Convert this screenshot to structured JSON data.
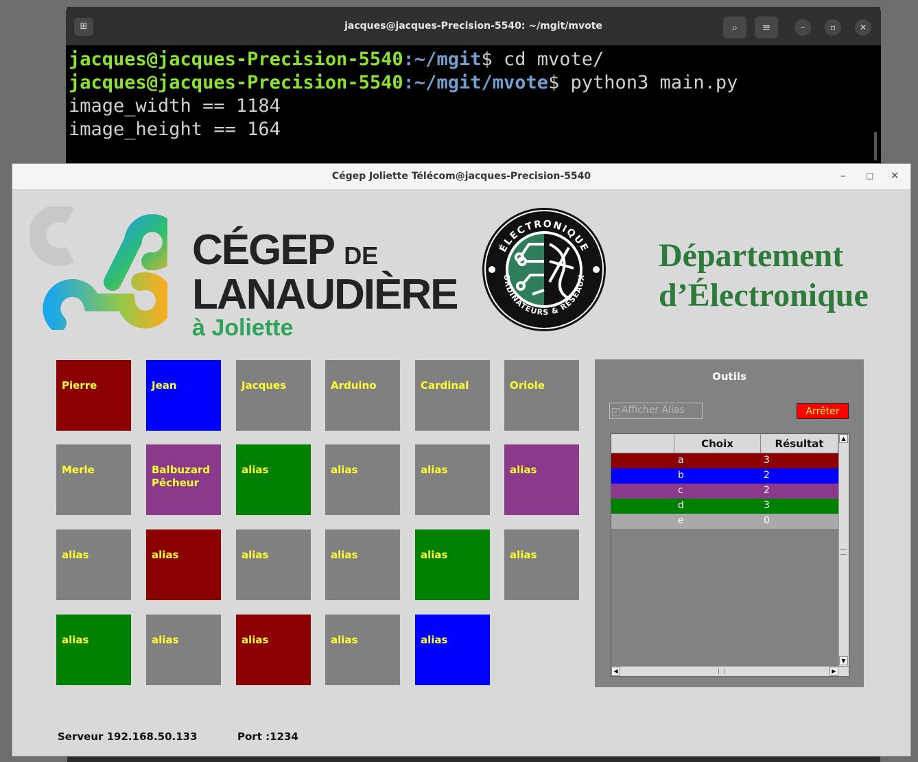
{
  "terminal": {
    "title": "jacques@jacques-Precision-5540: ~/mgit/mvote",
    "lines": [
      {
        "user": "jacques@jacques-Precision-5540",
        "path": ":~/mgit",
        "cmd": "$ cd mvote/"
      },
      {
        "user": "jacques@jacques-Precision-5540",
        "path": ":~/mgit/mvote",
        "cmd": "$ python3 main.py"
      }
    ],
    "output": [
      "image_width == 1184",
      "image_height == 164"
    ]
  },
  "app": {
    "title": "Cégep Joliette Télécom@jacques-Precision-5540",
    "header": {
      "cegep_line1": "CÉGEP",
      "cegep_de": "DE",
      "cegep_line2": "LANAUDIÈRE",
      "cegep_line3": "à Joliette",
      "badge_top": "ÉLECTRONIQUE",
      "badge_bottom": "ORDINATEURS & RÉSEAUX",
      "dept_line1": "Département",
      "dept_line2": "d’Électronique"
    },
    "tiles": [
      {
        "label": "Pierre",
        "color": "#8b0000"
      },
      {
        "label": "Jean",
        "color": "#0000ff"
      },
      {
        "label": "Jacques",
        "color": "#808080"
      },
      {
        "label": "Arduino",
        "color": "#808080"
      },
      {
        "label": "Cardinal",
        "color": "#808080"
      },
      {
        "label": "Oriole",
        "color": "#808080"
      },
      {
        "label": "Merle",
        "color": "#808080"
      },
      {
        "label": "Balbuzard Pêcheur",
        "color": "#8b3a8b"
      },
      {
        "label": "alias",
        "color": "#008000"
      },
      {
        "label": "alias",
        "color": "#808080"
      },
      {
        "label": "alias",
        "color": "#808080"
      },
      {
        "label": "alias",
        "color": "#8b3a8b"
      },
      {
        "label": "alias",
        "color": "#808080"
      },
      {
        "label": "alias",
        "color": "#8b0000"
      },
      {
        "label": "alias",
        "color": "#808080"
      },
      {
        "label": "alias",
        "color": "#808080"
      },
      {
        "label": "alias",
        "color": "#008000"
      },
      {
        "label": "alias",
        "color": "#808080"
      },
      {
        "label": "alias",
        "color": "#008000"
      },
      {
        "label": "alias",
        "color": "#808080"
      },
      {
        "label": "alias",
        "color": "#8b0000"
      },
      {
        "label": "alias",
        "color": "#808080"
      },
      {
        "label": "alias",
        "color": "#0000ff"
      }
    ],
    "tools": {
      "title": "Outils",
      "alias_checkbox": "Afficher Alias",
      "stop_button": "Arrêter",
      "columns": [
        "Choix",
        "Résultat"
      ],
      "rows": [
        {
          "choice": "a",
          "result": "3",
          "color": "#8b0000"
        },
        {
          "choice": "b",
          "result": "2",
          "color": "#0000ff"
        },
        {
          "choice": "c",
          "result": "2",
          "color": "#8b3a8b"
        },
        {
          "choice": "d",
          "result": "3",
          "color": "#008000"
        },
        {
          "choice": "e",
          "result": "0",
          "color": "#a9a9a9"
        }
      ]
    },
    "footer": {
      "server": "Serveur 192.168.50.133",
      "port": "Port :1234"
    }
  }
}
